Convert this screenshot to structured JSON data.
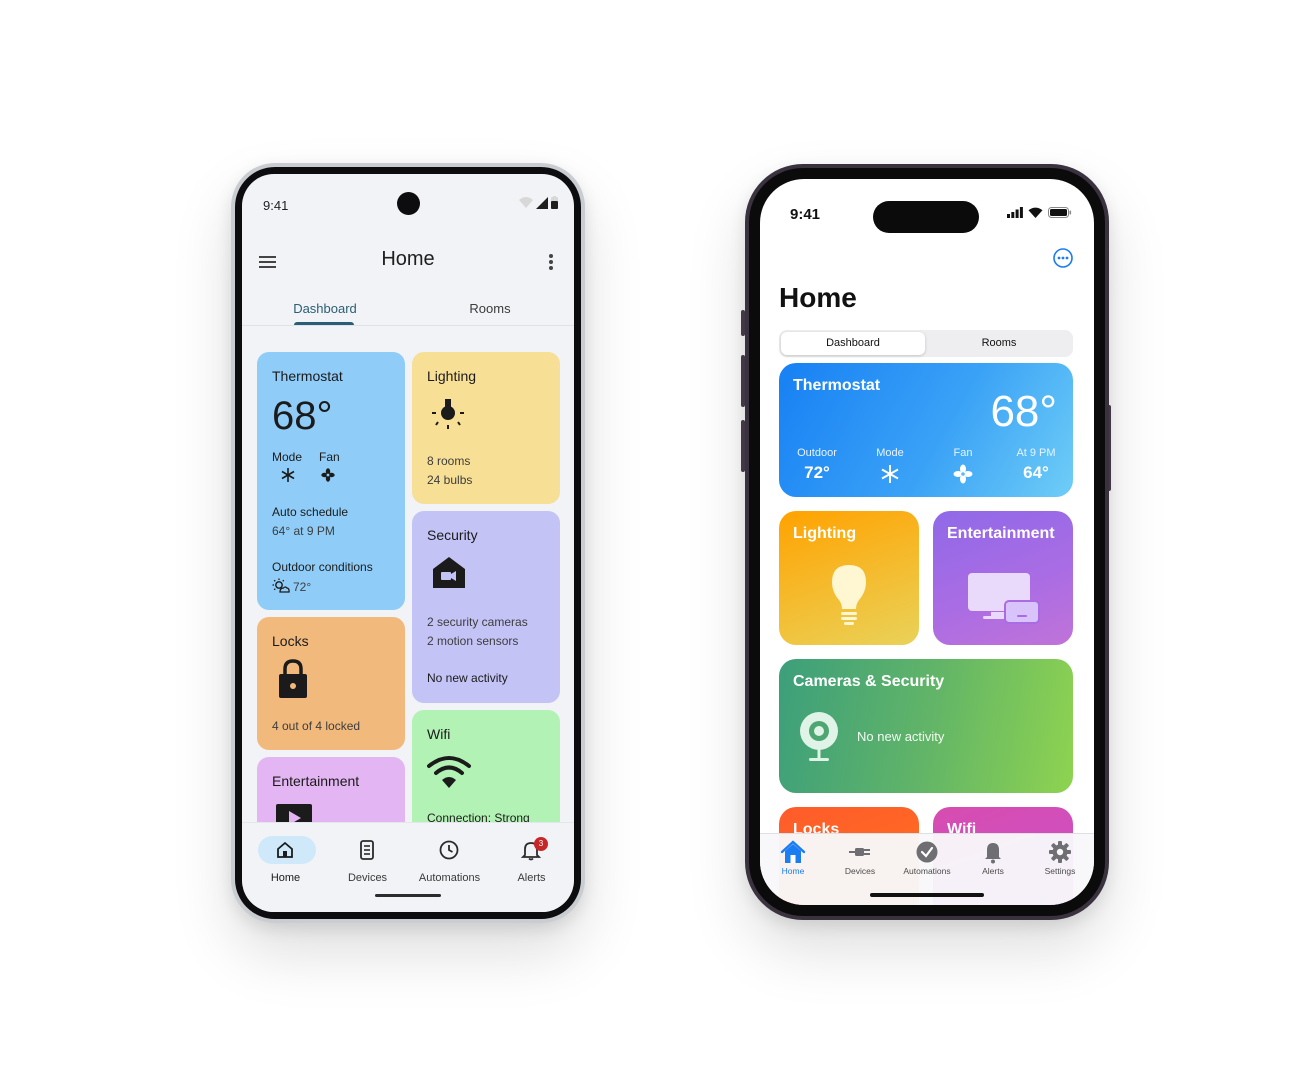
{
  "android": {
    "status": {
      "time": "9:41"
    },
    "appbar": {
      "title": "Home"
    },
    "tabs": [
      {
        "label": "Dashboard"
      },
      {
        "label": "Rooms"
      }
    ],
    "thermostat": {
      "title": "Thermostat",
      "temp": "68°",
      "mode_label": "Mode",
      "fan_label": "Fan",
      "schedule_title": "Auto schedule",
      "schedule_value": "64° at 9 PM",
      "outdoor_title": "Outdoor conditions",
      "outdoor_value": "72°"
    },
    "lighting": {
      "title": "Lighting",
      "rooms": "8 rooms",
      "bulbs": "24 bulbs"
    },
    "security": {
      "title": "Security",
      "cameras": "2 security cameras",
      "sensors": "2 motion sensors",
      "activity": "No new activity"
    },
    "locks": {
      "title": "Locks",
      "status": "4 out of 4 locked"
    },
    "wifi": {
      "title": "Wifi",
      "connection": "Connection: Strong"
    },
    "entertainment": {
      "title": "Entertainment"
    },
    "nav": [
      {
        "label": "Home",
        "icon": "home-icon"
      },
      {
        "label": "Devices",
        "icon": "devices-icon"
      },
      {
        "label": "Automations",
        "icon": "clock-icon"
      },
      {
        "label": "Alerts",
        "icon": "bell-icon",
        "badge": "3"
      }
    ],
    "colors": {
      "thermostat": "#8fcdf8",
      "lighting": "#f8df96",
      "security": "#c4c3f6",
      "locks": "#f2b97c",
      "wifi": "#b2f2b4",
      "entertainment": "#e3b5f2",
      "accent": "#2a5e74"
    }
  },
  "ios": {
    "status": {
      "time": "9:41"
    },
    "title": "Home",
    "segments": [
      {
        "label": "Dashboard"
      },
      {
        "label": "Rooms"
      }
    ],
    "thermostat": {
      "title": "Thermostat",
      "temp": "68°",
      "outdoor_label": "Outdoor",
      "outdoor_value": "72°",
      "mode_label": "Mode",
      "fan_label": "Fan",
      "schedule_label": "At 9 PM",
      "schedule_value": "64°"
    },
    "lighting": {
      "title": "Lighting"
    },
    "entertainment": {
      "title": "Entertainment"
    },
    "cameras": {
      "title": "Cameras & Security",
      "activity": "No new activity"
    },
    "peek": {
      "locks": "Locks",
      "wifi": "Wifi"
    },
    "tabs": [
      {
        "label": "Home",
        "icon": "house-icon"
      },
      {
        "label": "Devices",
        "icon": "plug-icon"
      },
      {
        "label": "Automations",
        "icon": "clock-icon"
      },
      {
        "label": "Alerts",
        "icon": "bell-icon"
      },
      {
        "label": "Settings",
        "icon": "gear-icon"
      }
    ],
    "colors": {
      "accent": "#1a7df2"
    }
  }
}
